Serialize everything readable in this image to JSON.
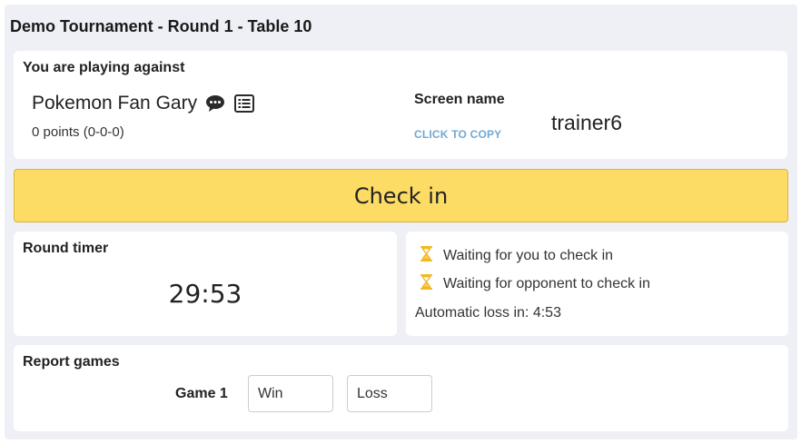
{
  "header": {
    "title": "Demo Tournament - Round 1 - Table 10"
  },
  "opponent": {
    "section_title": "You are playing against",
    "name": "Pokemon Fan Gary",
    "points": "0 points (0-0-0)",
    "icons": [
      "chat-bubble-icon",
      "list-icon"
    ],
    "screen_name_label": "Screen name",
    "copy_label": "CLICK TO COPY",
    "screen_name": "trainer6"
  },
  "checkin": {
    "label": "Check in",
    "color": "#fddc65"
  },
  "timer": {
    "title": "Round timer",
    "value": "29:53"
  },
  "status": {
    "items": [
      {
        "icon": "hourglass-icon",
        "text": "Waiting for you to check in"
      },
      {
        "icon": "hourglass-icon",
        "text": "Waiting for opponent to check in"
      }
    ],
    "auto_loss": "Automatic loss in: 4:53",
    "icon_color": "#f2b821"
  },
  "report": {
    "title": "Report games",
    "game_label": "Game 1",
    "win_label": "Win",
    "loss_label": "Loss"
  }
}
